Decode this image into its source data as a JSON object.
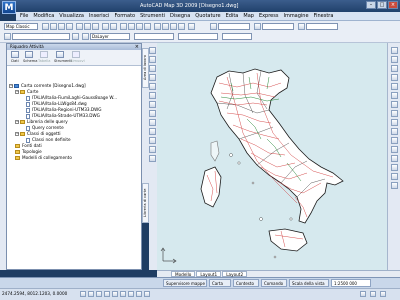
{
  "app": {
    "title": "AutoCAD Map 3D 2009  [Disegno1.dwg]",
    "logo": "M"
  },
  "menu": [
    "File",
    "Modifica",
    "Visualizza",
    "Inserisci",
    "Formato",
    "Strumenti",
    "Disegna",
    "Quotature",
    "Edita",
    "Map",
    "Express",
    "Immagine",
    "Finestra"
  ],
  "toolbar": {
    "workspace": "Map Classic",
    "layer_combo": "",
    "color_combo": "DaLayer"
  },
  "task_pane": {
    "title": "Riquadro Attività",
    "tools": [
      {
        "label": "Dati",
        "enabled": true
      },
      {
        "label": "Schema",
        "enabled": true
      },
      {
        "label": "Tabella",
        "enabled": false
      },
      {
        "label": "Strumenti",
        "enabled": true
      },
      {
        "label": "Rimuovi",
        "enabled": false
      }
    ],
    "tree": [
      {
        "label": "Carta corrente [Disegno1.dwg]",
        "level": 0,
        "kind": "map",
        "exp": "-"
      },
      {
        "label": "Carte",
        "level": 1,
        "kind": "folder",
        "exp": "-"
      },
      {
        "label": "ITALIA/Italia-FiumiLaghi-Gauss8oage W...",
        "level": 2,
        "kind": "dwg"
      },
      {
        "label": "ITALIA/Italia-LLWgs84.dwg",
        "level": 2,
        "kind": "dwg"
      },
      {
        "label": "ITALIA/Italia-Regioni-UTM33.DWG",
        "level": 2,
        "kind": "dwg"
      },
      {
        "label": "ITALIA/Italia-Strade-UTM33.DWG",
        "level": 2,
        "kind": "dwg"
      },
      {
        "label": "Libreria delle query",
        "level": 1,
        "kind": "folder",
        "exp": "-"
      },
      {
        "label": "Query corrente",
        "level": 2,
        "kind": "dwg"
      },
      {
        "label": "Classi di oggetti",
        "level": 1,
        "kind": "folder",
        "exp": "-"
      },
      {
        "label": "Classi non definite",
        "level": 2,
        "kind": "dwg"
      },
      {
        "label": "Fonti dati",
        "level": 1,
        "kind": "folder"
      },
      {
        "label": "Topologie",
        "level": 1,
        "kind": "folder"
      },
      {
        "label": "Modelli di collegamento",
        "level": 1,
        "kind": "folder"
      }
    ],
    "side_tabs": [
      "Area di lavoro",
      "Libreria di carte"
    ]
  },
  "layout_tabs": [
    "Modello",
    "Layout1",
    "Layout2"
  ],
  "command_tabs": [
    "Supervisore mappe",
    "Carta",
    "Contesto",
    "Comando",
    "Scala della vista"
  ],
  "status": {
    "coordinates": "2474.2594, 8012.1203, 0.0000",
    "scale": "1:2500 000"
  },
  "colors": {
    "sea": "#d6e9ee",
    "land": "#ffffff",
    "roads": "#d03a3a",
    "rivers": "#2a8a3a",
    "boundaries": "#222222"
  },
  "icons": [
    "map-icon",
    "folder-icon",
    "drawing-icon",
    "close-icon",
    "layers-icon",
    "zoom-icon",
    "pan-icon"
  ]
}
